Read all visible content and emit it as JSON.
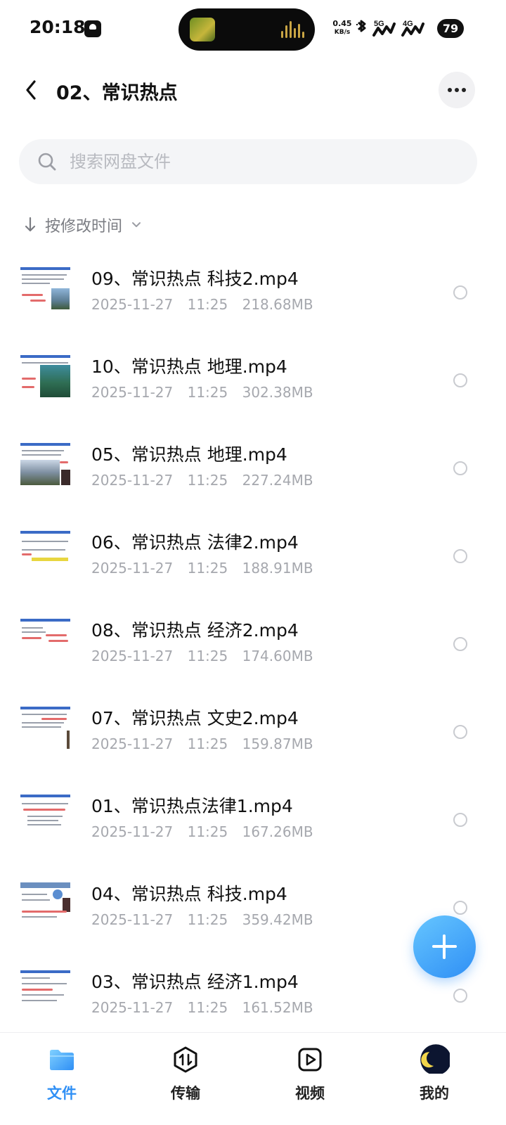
{
  "status_bar": {
    "time": "20:18",
    "net_speed_value": "0.45",
    "net_speed_unit": "KB/s",
    "battery": "79",
    "signal_labels": [
      "5G",
      "4G"
    ]
  },
  "header": {
    "title": "02、常识热点"
  },
  "search": {
    "placeholder": "搜索网盘文件"
  },
  "sort": {
    "label": "按修改时间"
  },
  "files": [
    {
      "name": "09、常识热点 科技2.mp4",
      "date": "2025-11-27",
      "time": "11:25",
      "size": "218.68MB"
    },
    {
      "name": "10、常识热点 地理.mp4",
      "date": "2025-11-27",
      "time": "11:25",
      "size": "302.38MB"
    },
    {
      "name": "05、常识热点 地理.mp4",
      "date": "2025-11-27",
      "time": "11:25",
      "size": "227.24MB"
    },
    {
      "name": "06、常识热点 法律2.mp4",
      "date": "2025-11-27",
      "time": "11:25",
      "size": "188.91MB"
    },
    {
      "name": "08、常识热点 经济2.mp4",
      "date": "2025-11-27",
      "time": "11:25",
      "size": "174.60MB"
    },
    {
      "name": "07、常识热点 文史2.mp4",
      "date": "2025-11-27",
      "time": "11:25",
      "size": "159.87MB"
    },
    {
      "name": "01、常识热点法律1.mp4",
      "date": "2025-11-27",
      "time": "11:25",
      "size": "167.26MB"
    },
    {
      "name": "04、常识热点 科技.mp4",
      "date": "2025-11-27",
      "time": "11:25",
      "size": "359.42MB"
    },
    {
      "name": "03、常识热点 经济1.mp4",
      "date": "2025-11-27",
      "time": "11:25",
      "size": "161.52MB"
    }
  ],
  "bottom_nav": {
    "items": [
      {
        "label": "文件",
        "icon": "folder-icon",
        "active": true
      },
      {
        "label": "传输",
        "icon": "transfer-icon",
        "active": false
      },
      {
        "label": "视频",
        "icon": "video-icon",
        "active": false
      },
      {
        "label": "我的",
        "icon": "avatar-icon",
        "active": false
      }
    ]
  },
  "colors": {
    "accent": "#2f8ff5",
    "meta_text": "#a6a8ae"
  }
}
